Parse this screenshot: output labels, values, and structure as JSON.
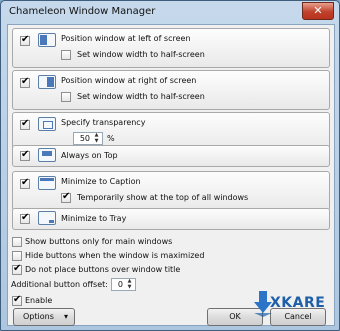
{
  "window": {
    "title": "Chameleon Window Manager",
    "close_glyph": "✕"
  },
  "groups": {
    "left": {
      "checked": true,
      "label": "Position window at left of screen",
      "sub_label": "Set window width to half-screen",
      "sub_checked": false
    },
    "right": {
      "checked": true,
      "label": "Position window at right of screen",
      "sub_label": "Set window width to half-screen",
      "sub_checked": false
    },
    "transparency": {
      "checked": true,
      "label": "Specify transparency",
      "value": "50",
      "unit": "%"
    },
    "ontop": {
      "checked": true,
      "label": "Always on Top"
    },
    "caption": {
      "checked": true,
      "label": "Minimize to Caption",
      "sub_label": "Temporarily show at the top of all windows",
      "sub_checked": true
    },
    "tray": {
      "checked": true,
      "label": "Minimize to Tray"
    }
  },
  "options": {
    "main_windows": {
      "checked": false,
      "label": "Show buttons only for main windows"
    },
    "maximized": {
      "checked": false,
      "label": "Hide buttons when the window is maximized"
    },
    "no_title": {
      "checked": true,
      "label": "Do not place buttons over window title"
    },
    "offset_label": "Additional button offset:",
    "offset_value": "0",
    "enable": {
      "checked": true,
      "label": "Enable"
    }
  },
  "buttons": {
    "options": "Options",
    "options_arrow": "▾",
    "ok": "OK",
    "cancel": "Cancel"
  },
  "spin_arrows": {
    "up": "▲",
    "down": "▼"
  },
  "watermark": {
    "text": "XKARE"
  },
  "icons": {
    "left": "window-left-icon",
    "right": "window-right-icon",
    "transparency": "transparency-icon",
    "ontop": "always-on-top-icon",
    "caption": "minimize-caption-icon",
    "tray": "minimize-tray-icon"
  },
  "colors": {
    "accent": "#1e5fa8",
    "close": "#c0412a",
    "titlebar": "#bcd2e8"
  }
}
